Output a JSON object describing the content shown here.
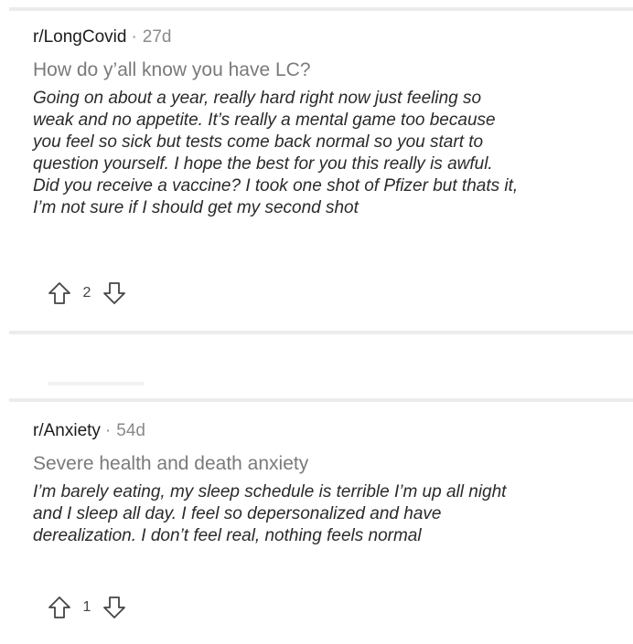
{
  "posts": [
    {
      "subreddit": "r/LongCovid",
      "separator": "·",
      "age": "27d",
      "title": "How do y’all know you have LC?",
      "comment_lines": [
        "Going on about a year, really hard right now just feeling so",
        "weak and no appetite. It’s really a mental game too because",
        "you feel so sick but tests come back normal so you start to",
        "question yourself. I hope the best for you this really is awful.",
        "Did you receive a vaccine? I took one shot of Pfizer but thats it,",
        "I’m not sure if I should get my second shot"
      ],
      "score": "2"
    },
    {
      "subreddit": "r/Anxiety",
      "separator": "·",
      "age": "54d",
      "title": "Severe health and death anxiety",
      "comment_lines": [
        "I’m barely eating, my sleep schedule is terrible I’m up all night",
        "and I sleep all day. I feel so depersonalized and have",
        "derealization. I don’t feel real, nothing feels normal"
      ],
      "score": "1"
    }
  ],
  "icons": {
    "upvote": "upvote-arrow-icon",
    "downvote": "downvote-arrow-icon"
  },
  "colors": {
    "divider": "#ececec",
    "meta_muted": "#8a8a8a",
    "title_gray": "#7a7a7a",
    "comment_text": "#2a2a2a"
  }
}
